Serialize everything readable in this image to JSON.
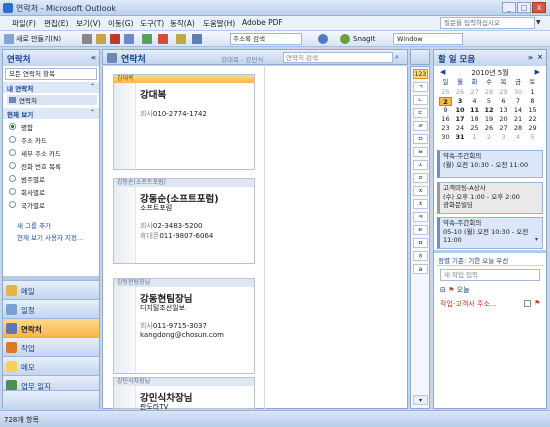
{
  "window": {
    "title": "연락처 - Microsoft Outlook",
    "buttons": [
      "_",
      "□",
      "X"
    ]
  },
  "menu": {
    "items": [
      "파일(F)",
      "편집(E)",
      "보기(V)",
      "이동(G)",
      "도구(T)",
      "동작(A)",
      "도움말(H)",
      "Adobe PDF"
    ],
    "help_placeholder": "질문을 입력하십시오"
  },
  "toolbar": {
    "new_label": "새로 만들기(N)",
    "address_search_placeholder": "주소록 검색",
    "snagit_label": "SnagIt",
    "window_label": "Window"
  },
  "nav": {
    "title": "연락처",
    "all_contacts_dropdown": "모든 연락처 항목",
    "my_contacts_header": "내 연락처",
    "my_contacts_item": "연락처",
    "current_view_header": "현재 보기",
    "views": [
      {
        "label": "명함",
        "selected": true
      },
      {
        "label": "주소 카드",
        "selected": false
      },
      {
        "label": "세부 주소 카드",
        "selected": false
      },
      {
        "label": "전화 번호 목록",
        "selected": false
      },
      {
        "label": "범주별로",
        "selected": false
      },
      {
        "label": "회사별로",
        "selected": false
      },
      {
        "label": "국가별로",
        "selected": false
      }
    ],
    "link_new_group": "새 그룹 추가",
    "link_customize": "현재 보기 사용자 지정...",
    "modules": [
      {
        "label": "메일",
        "active": false,
        "color": "#e6b43c"
      },
      {
        "label": "일정",
        "active": false,
        "color": "#7c9fd6"
      },
      {
        "label": "연락처",
        "active": true,
        "color": "#5b7ab3"
      },
      {
        "label": "작업",
        "active": false,
        "color": "#d87a2a"
      },
      {
        "label": "메모",
        "active": false,
        "color": "#f2d25a"
      },
      {
        "label": "업무 일지",
        "active": false,
        "color": "#4d8f4d"
      }
    ]
  },
  "main": {
    "title": "연락처",
    "range": "강대복 - 강민식",
    "search_placeholder": "연락처 검색",
    "cards": [
      {
        "header": "강대복",
        "name": "강대복",
        "lines": [
          {
            "label": "회사",
            "value": "010-2774-1742"
          }
        ],
        "selected": true
      },
      {
        "header": "강동순(소프트포럼)",
        "name": "강동순(소프트포럼)",
        "lines": [
          {
            "label": "",
            "value": "소프트포럼"
          },
          {
            "label": "회사",
            "value": "02-3483-5200"
          },
          {
            "label": "휴대폰",
            "value": "011-9807-6064"
          }
        ],
        "selected": false
      },
      {
        "header": "강동현팀장님",
        "name": "강동현팀장님",
        "lines": [
          {
            "label": "",
            "value": "디지털조선일보"
          },
          {
            "label": "회사",
            "value": "011-9715-3037"
          },
          {
            "label": "",
            "value": "kangdong@chosun.com"
          }
        ],
        "selected": false
      },
      {
        "header": "강민식차장님",
        "name": "강민식차장님",
        "lines": [
          {
            "label": "",
            "value": "판도라TV"
          }
        ],
        "selected": false
      }
    ]
  },
  "index_bar": [
    "123",
    "ㄱ",
    "ㄴ",
    "ㄷ",
    "ㄹ",
    "ㅁ",
    "ㅂ",
    "ㅅ",
    "ㅇ",
    "ㅈ",
    "ㅊ",
    "ㅋ",
    "ㅌ",
    "ㅍ",
    "ㅎ",
    "a"
  ],
  "todo": {
    "title": "할 일 모음",
    "calendar": {
      "month": "2010년 5월",
      "dow": [
        "일",
        "월",
        "화",
        "수",
        "목",
        "금",
        "토"
      ],
      "weeks": [
        [
          "25",
          "26",
          "27",
          "28",
          "29",
          "30",
          "1"
        ],
        [
          "2",
          "3",
          "4",
          "5",
          "6",
          "7",
          "8"
        ],
        [
          "9",
          "10",
          "11",
          "12",
          "13",
          "14",
          "15"
        ],
        [
          "16",
          "17",
          "18",
          "19",
          "20",
          "21",
          "22"
        ],
        [
          "23",
          "24",
          "25",
          "26",
          "27",
          "28",
          "29"
        ],
        [
          "30",
          "31",
          "1",
          "2",
          "3",
          "4",
          "5"
        ]
      ],
      "today": "2"
    },
    "appointments": [
      {
        "line1": "약속-주간회의",
        "line2": "(월) 오전 10:30 - 오전 11:00",
        "line3": ""
      },
      {
        "line1": "고객미팅-A상사",
        "line2": "(수) 오후 1:00 - 오후 2:00",
        "line3": "광화문빌딩"
      },
      {
        "line1": "약속-주간회의",
        "line2": "05-10 (월) 오전 10:30 - 오전",
        "line3": "11:00"
      }
    ],
    "task_sort": "정렬 기준: 기한 오늘 우선",
    "task_placeholder": "새 작업 입력",
    "task_group": "오늘",
    "task_item": "작업-고객사 주소..."
  },
  "status": {
    "text": "728개 항목"
  }
}
